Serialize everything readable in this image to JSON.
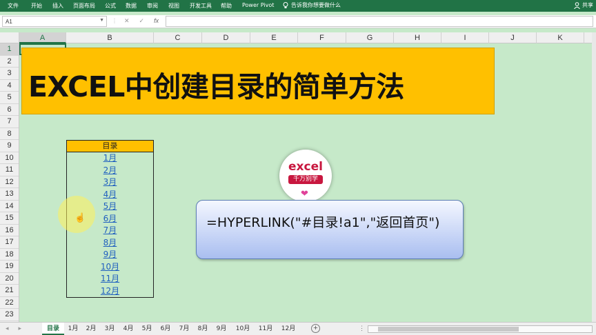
{
  "ribbon": {
    "tabs": [
      "文件",
      "开始",
      "插入",
      "页面布局",
      "公式",
      "数据",
      "审阅",
      "视图",
      "开发工具",
      "帮助",
      "Power Pivot"
    ],
    "tell_me": "告诉我你想要做什么",
    "share": "共享"
  },
  "formula_bar": {
    "name_box": "A1",
    "formula": ""
  },
  "columns": [
    "A",
    "B",
    "C",
    "D",
    "E",
    "F",
    "G",
    "H",
    "I",
    "J",
    "K"
  ],
  "rows": [
    "1",
    "2",
    "3",
    "4",
    "5",
    "6",
    "7",
    "8",
    "9",
    "10",
    "11",
    "12",
    "13",
    "14",
    "15",
    "16",
    "17",
    "18",
    "19",
    "20",
    "21",
    "22",
    "23"
  ],
  "banner": {
    "title": "EXCEL中创建目录的简单方法",
    "color": "#ffc000"
  },
  "toc": {
    "header": "目录",
    "links": [
      "1月",
      "2月",
      "3月",
      "4月",
      "5月",
      "6月",
      "7月",
      "8月",
      "9月",
      "10月",
      "11月",
      "12月"
    ]
  },
  "logo": {
    "line1": "excel",
    "line2": "千万别学"
  },
  "formula_callout": "=HYPERLINK(\"#目录!a1\",\"返回首页\")",
  "sheet_tabs": [
    "目录",
    "1月",
    "2月",
    "3月",
    "4月",
    "5月",
    "6月",
    "7月",
    "8月",
    "9月",
    "10月",
    "11月",
    "12月"
  ],
  "active_sheet": "目录",
  "colors": {
    "ribbon": "#217346",
    "grid_bg": "#c6e9c9",
    "link": "#1f5fbf"
  }
}
